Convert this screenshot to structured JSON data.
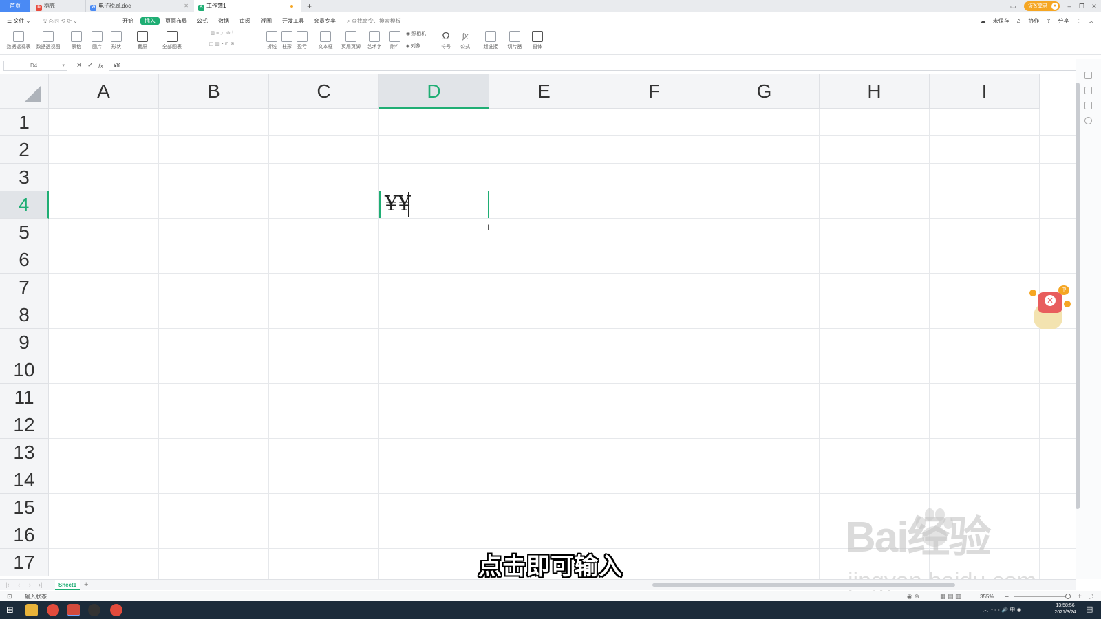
{
  "tabs": {
    "home": "首页",
    "daoke": "稻壳",
    "doc": "电子税局.doc",
    "workbook": "工作簿1",
    "new_tab": "+"
  },
  "titlebar": {
    "visitor_login": "访客登录"
  },
  "menu": {
    "file": "文件",
    "items": [
      "开始",
      "插入",
      "页面布局",
      "公式",
      "数据",
      "审阅",
      "视图",
      "开发工具",
      "会员专享"
    ],
    "search": "查找命令、搜索模板",
    "unsaved": "未保存",
    "collaborate": "协作",
    "share": "分享"
  },
  "ribbon": {
    "items": [
      "数据透视表",
      "数据透视图",
      "表格",
      "图片",
      "形状",
      "截屏",
      "全部图表",
      "折线",
      "柱形",
      "盈亏",
      "文本框",
      "页眉页脚",
      "艺术字",
      "附件",
      "照相机",
      "对象",
      "符号",
      "公式",
      "超链接",
      "切片器",
      "窗体"
    ]
  },
  "formula_bar": {
    "cell_ref": "D4",
    "fx": "fx",
    "content": "¥¥"
  },
  "grid": {
    "columns": [
      "A",
      "B",
      "C",
      "D",
      "E",
      "F",
      "G",
      "H",
      "I"
    ],
    "rows": [
      "1",
      "2",
      "3",
      "4",
      "5",
      "6",
      "7",
      "8",
      "9",
      "10",
      "11",
      "12",
      "13",
      "14",
      "15",
      "16",
      "17"
    ],
    "active_column": "D",
    "active_row": "4",
    "active_cell_value": "¥¥"
  },
  "sheets": {
    "tabs": [
      "Sheet1"
    ],
    "add": "+"
  },
  "status": {
    "mode": "输入状态",
    "zoom": "355%"
  },
  "overlay": {
    "subtitle": "点击即可输入",
    "watermark_logo": "Bai经验",
    "watermark_url": "jingyan.baidu.com"
  },
  "taskbar": {
    "time": "13:58:56",
    "date": "2021/3/24",
    "ime": "中"
  },
  "colors": {
    "accent": "#1fae74",
    "tab_blue": "#4a8af4",
    "login_orange": "#f5a623"
  }
}
